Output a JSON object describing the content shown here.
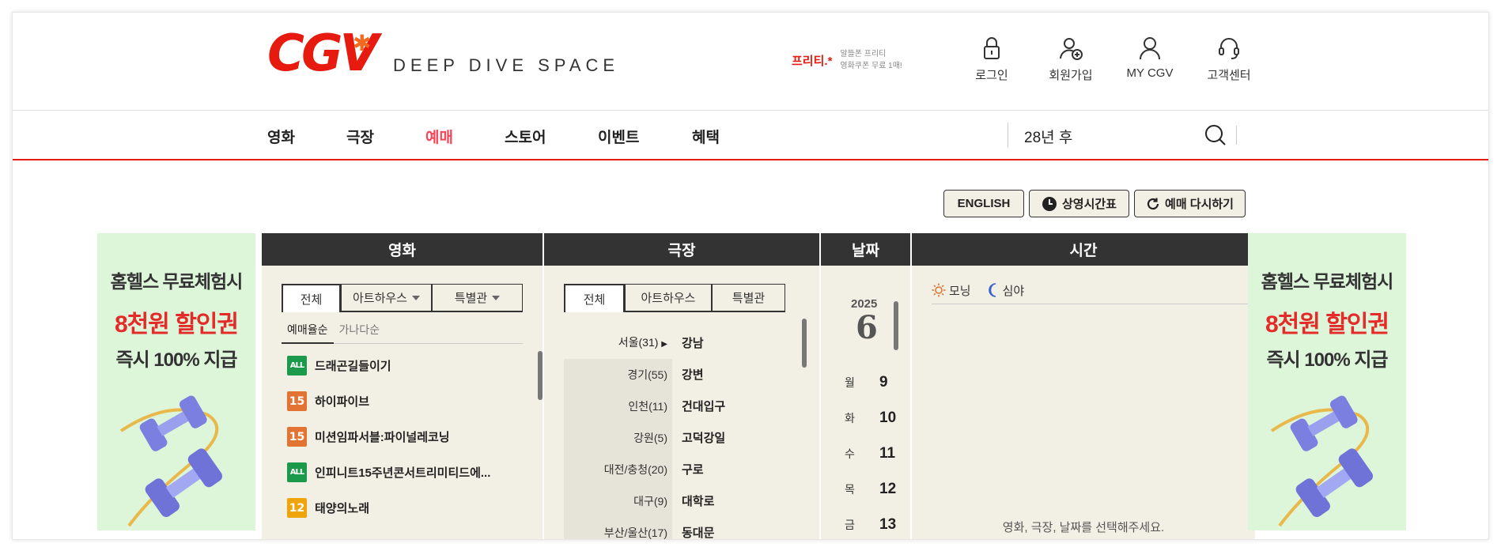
{
  "header": {
    "logo_text": "CGV",
    "logo_sub": "DEEP DIVE SPACE",
    "promo_brand": "프리티.*",
    "promo_line1": "알뜰폰 프리티",
    "promo_line2": "영화쿠폰 무료 1매!",
    "util": [
      {
        "label": "로그인",
        "icon": "lock-icon"
      },
      {
        "label": "회원가입",
        "icon": "user-add-icon"
      },
      {
        "label": "MY CGV",
        "icon": "user-icon"
      },
      {
        "label": "고객센터",
        "icon": "headset-icon"
      }
    ]
  },
  "nav": {
    "items": [
      "영화",
      "극장",
      "예매",
      "스토어",
      "이벤트",
      "혜택"
    ],
    "active": "예매",
    "search_text": "28년 후"
  },
  "top_buttons": {
    "english": "ENGLISH",
    "schedule": "상영시간표",
    "reset": "예매 다시하기"
  },
  "ad": {
    "line1": "홈헬스 무료체험시",
    "line2": "8천원 할인권",
    "line3": "즉시 100% 지급"
  },
  "movie_panel": {
    "title": "영화",
    "tabs": [
      "전체",
      "아트하우스",
      "특별관"
    ],
    "sorts": [
      "예매율순",
      "가나다순"
    ],
    "movies": [
      {
        "rating": "ALL",
        "title": "드래곤길들이기"
      },
      {
        "rating": "15",
        "title": "하이파이브"
      },
      {
        "rating": "15",
        "title": "미션임파서블:파이널레코닝"
      },
      {
        "rating": "ALL",
        "title": "인피니트15주년콘서트리미티드에..."
      },
      {
        "rating": "12",
        "title": "태양의노래"
      }
    ]
  },
  "theater_panel": {
    "title": "극장",
    "tabs": [
      "전체",
      "아트하우스",
      "특별관"
    ],
    "regions": [
      "서울(31)",
      "경기(55)",
      "인천(11)",
      "강원(5)",
      "대전/충청(20)",
      "대구(9)",
      "부산/울산(17)"
    ],
    "theaters": [
      "강남",
      "강변",
      "건대입구",
      "고덕강일",
      "구로",
      "대학로",
      "동대문"
    ]
  },
  "date_panel": {
    "title": "날짜",
    "year": "2025",
    "month": "6",
    "days": [
      {
        "dow": "월",
        "num": "9"
      },
      {
        "dow": "화",
        "num": "10"
      },
      {
        "dow": "수",
        "num": "11"
      },
      {
        "dow": "목",
        "num": "12"
      },
      {
        "dow": "금",
        "num": "13"
      }
    ]
  },
  "time_panel": {
    "title": "시간",
    "morning": "모닝",
    "night": "심야",
    "message": "영화, 극장, 날짜를 선택해주세요."
  },
  "colors": {
    "brand_red": "#e71a0f",
    "active_nav": "#fb4357",
    "panel_bg": "#f2f0e5",
    "panel_head": "#333333",
    "ad_bg": "#ddf5d9"
  }
}
